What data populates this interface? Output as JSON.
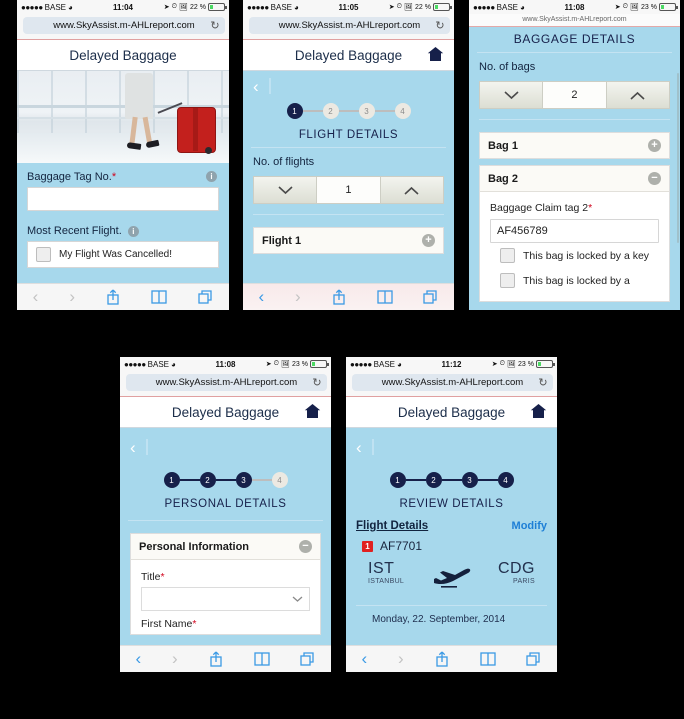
{
  "status_bar": {
    "signal_dots": "●●●●●",
    "carrier": "BASE",
    "wifi_icon": "wifi-icon",
    "location_icon": "location-arrow-icon",
    "alarm_icon": "alarm-clock-icon",
    "rotation_icon": "rotation-lock-icon",
    "battery_icon": "battery-icon"
  },
  "browser": {
    "url": "www.SkyAssist.m-AHLreport.com",
    "reload_icon": "↻",
    "toolbar": {
      "back_icon": "‹",
      "forward_icon": "›",
      "share_icon": "share-icon",
      "bookmarks_icon": "bookmarks-icon",
      "tabs_icon": "tabs-icon"
    }
  },
  "app": {
    "title": "Delayed Baggage",
    "home_icon": "home-icon",
    "back_icon": "‹"
  },
  "screens": [
    {
      "id": "screen-1-landing",
      "time": "11:04",
      "battery_pct": "22 %",
      "hero_image": "woman-pulling-red-suitcase-airport",
      "fields": [
        {
          "label": "Baggage Tag No.",
          "required": true,
          "info_icon": "info-icon",
          "value": "",
          "type": "text"
        },
        {
          "label": "Most Recent Flight.",
          "required": false,
          "info_icon": "info-icon",
          "type": "checkbox",
          "checkbox_label": "My Flight Was Cancelled!",
          "checked": false
        }
      ]
    },
    {
      "id": "screen-2-flight-details",
      "time": "11:05",
      "battery_pct": "22 %",
      "steps": [
        {
          "n": "1",
          "active": true
        },
        {
          "n": "2",
          "active": false
        },
        {
          "n": "3",
          "active": false
        },
        {
          "n": "4",
          "active": false
        }
      ],
      "section_title": "FLIGHT DETAILS",
      "stepper": {
        "label": "No. of flights",
        "value": "1",
        "down_icon": "chevron-down-icon",
        "up_icon": "chevron-up-icon"
      },
      "card": {
        "title": "Flight 1",
        "toggle_icon": "plus-circle-icon"
      }
    },
    {
      "id": "screen-3-baggage-details",
      "time": "11:08",
      "battery_pct": "23 %",
      "section_title": "BAGGAGE DETAILS",
      "stepper": {
        "label": "No. of bags",
        "value": "2",
        "down_icon": "chevron-down-icon",
        "up_icon": "chevron-up-icon"
      },
      "bags": [
        {
          "title": "Bag 1",
          "toggle_icon": "plus-circle-icon",
          "expanded": false
        },
        {
          "title": "Bag 2",
          "toggle_icon": "minus-circle-icon",
          "expanded": true,
          "field_label": "Baggage Claim tag 2",
          "required": true,
          "field_value": "AF456789",
          "checkboxes": [
            {
              "label": "This bag is locked by a key",
              "checked": false
            },
            {
              "label": "This bag is locked by a",
              "checked": false
            }
          ]
        }
      ]
    },
    {
      "id": "screen-4-personal-details",
      "time": "11:08",
      "battery_pct": "23 %",
      "steps": [
        {
          "n": "1",
          "active": true
        },
        {
          "n": "2",
          "active": true
        },
        {
          "n": "3",
          "active": true
        },
        {
          "n": "4",
          "active": false
        }
      ],
      "section_title": "PERSONAL DETAILS",
      "card": {
        "title": "Personal Information",
        "toggle_icon": "minus-circle-icon",
        "fields": [
          {
            "label": "Title",
            "required": true,
            "type": "select",
            "value": "",
            "chevron_icon": "chevron-down-icon"
          },
          {
            "label": "First Name",
            "required": true,
            "type": "text",
            "value": ""
          }
        ]
      }
    },
    {
      "id": "screen-5-review-details",
      "time": "11:12",
      "battery_pct": "23 %",
      "steps": [
        {
          "n": "1",
          "active": true
        },
        {
          "n": "2",
          "active": true
        },
        {
          "n": "3",
          "active": true
        },
        {
          "n": "4",
          "active": true
        }
      ],
      "section_title": "REVIEW DETAILS",
      "review": {
        "heading": "Flight Details",
        "modify_label": "Modify",
        "flight_badge": "1",
        "flight_number": "AF7701",
        "origin_code": "IST",
        "origin_city": "ISTANBUL",
        "destination_code": "CDG",
        "destination_city": "PARIS",
        "plane_icon": "airplane-icon",
        "date": "Monday, 22. September, 2014"
      }
    }
  ],
  "colors": {
    "app_blue": "#a7d8ec",
    "navy": "#16204a",
    "accent_link": "#1e7fd6",
    "required_red": "#d0021b",
    "badge_red": "#e02020"
  }
}
